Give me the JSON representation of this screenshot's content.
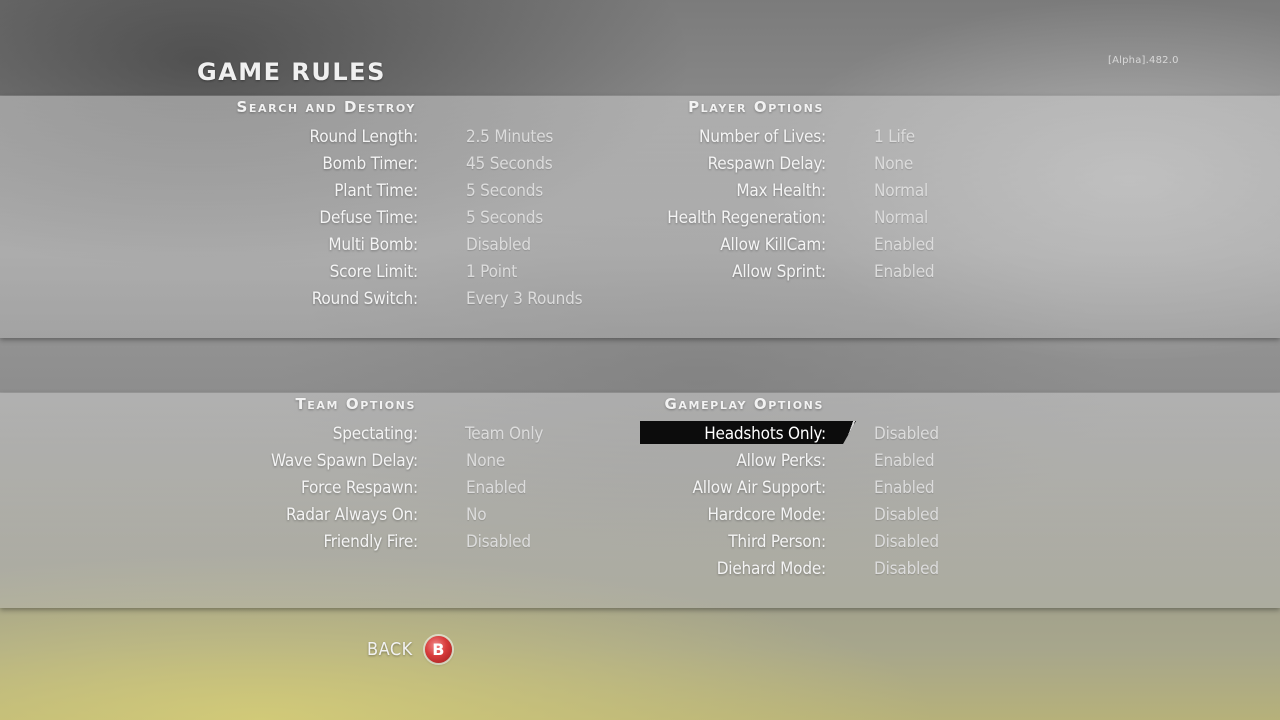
{
  "version": "[Alpha].482.0",
  "title": "GAME RULES",
  "sections": {
    "search_destroy": {
      "title": "Search and Destroy",
      "rows": [
        {
          "label": "Round Length:",
          "value": "2.5 Minutes"
        },
        {
          "label": "Bomb Timer:",
          "value": "45 Seconds"
        },
        {
          "label": "Plant Time:",
          "value": "5 Seconds"
        },
        {
          "label": "Defuse Time:",
          "value": "5 Seconds"
        },
        {
          "label": "Multi Bomb:",
          "value": "Disabled"
        },
        {
          "label": "Score Limit:",
          "value": "1 Point"
        },
        {
          "label": "Round Switch:",
          "value": "Every 3 Rounds"
        }
      ]
    },
    "player_options": {
      "title": "Player Options",
      "rows": [
        {
          "label": "Number of Lives:",
          "value": "1 Life"
        },
        {
          "label": "Respawn Delay:",
          "value": "None"
        },
        {
          "label": "Max Health:",
          "value": "Normal"
        },
        {
          "label": "Health Regeneration:",
          "value": "Normal"
        },
        {
          "label": "Allow KillCam:",
          "value": "Enabled"
        },
        {
          "label": "Allow Sprint:",
          "value": "Enabled"
        }
      ]
    },
    "team_options": {
      "title": "Team Options",
      "rows": [
        {
          "label": "Spectating:",
          "value": "Team Only"
        },
        {
          "label": "Wave Spawn Delay:",
          "value": "None"
        },
        {
          "label": "Force Respawn:",
          "value": "Enabled"
        },
        {
          "label": "Radar Always On:",
          "value": "No"
        },
        {
          "label": "Friendly Fire:",
          "value": "Disabled"
        }
      ]
    },
    "gameplay_options": {
      "title": "Gameplay Options",
      "rows": [
        {
          "label": "Headshots Only:",
          "value": "Disabled"
        },
        {
          "label": "Allow Perks:",
          "value": "Enabled"
        },
        {
          "label": "Allow Air Support:",
          "value": "Enabled"
        },
        {
          "label": "Hardcore Mode:",
          "value": "Disabled"
        },
        {
          "label": "Third Person:",
          "value": "Disabled"
        },
        {
          "label": "Diehard Mode:",
          "value": "Disabled"
        }
      ]
    }
  },
  "back": {
    "label": "BACK",
    "button_glyph": "B",
    "button_color": "#d83b3b"
  }
}
